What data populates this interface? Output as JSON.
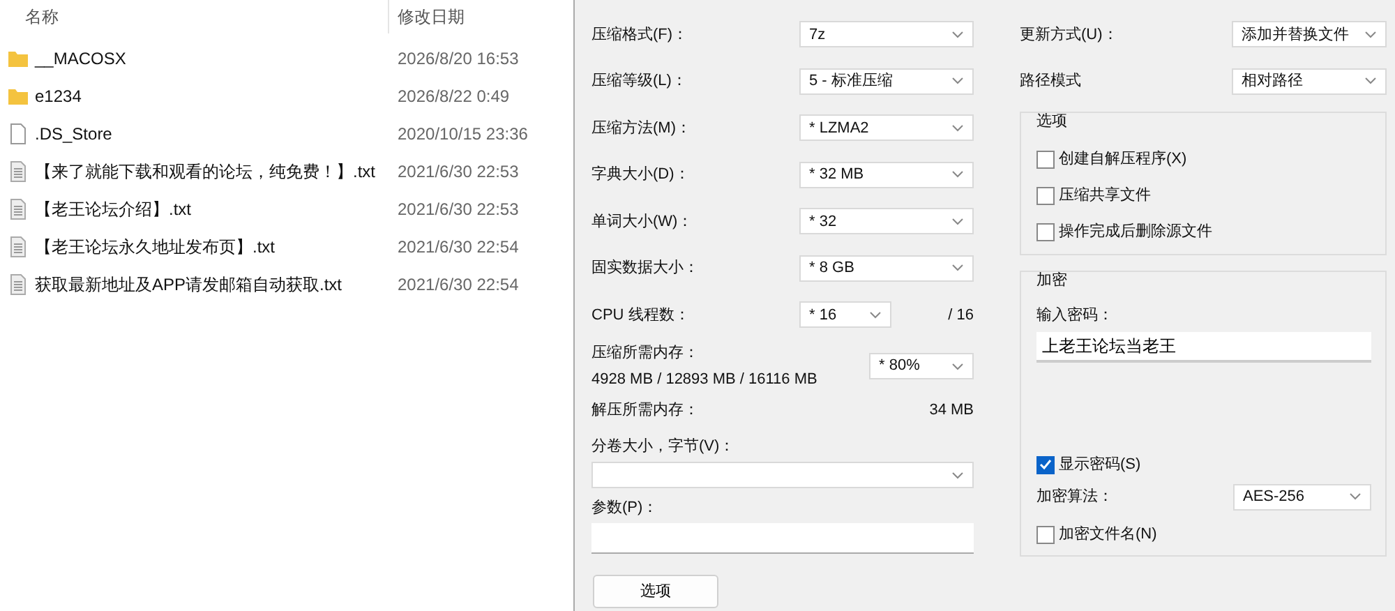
{
  "file_list": {
    "columns": [
      "名称",
      "修改日期"
    ],
    "rows": [
      {
        "kind": "folder",
        "name": "__MACOSX",
        "modified": "2026/8/20 16:53"
      },
      {
        "kind": "folder",
        "name": "e1234",
        "modified": "2026/8/22 0:49"
      },
      {
        "kind": "file",
        "name": ".DS_Store",
        "modified": "2020/10/15 23:36"
      },
      {
        "kind": "text",
        "name": "【来了就能下载和观看的论坛，纯免费！】.txt",
        "modified": "2021/6/30 22:53"
      },
      {
        "kind": "text",
        "name": "【老王论坛介绍】.txt",
        "modified": "2021/6/30 22:53"
      },
      {
        "kind": "text",
        "name": "【老王论坛永久地址发布页】.txt",
        "modified": "2021/6/30 22:54"
      },
      {
        "kind": "text",
        "name": "获取最新地址及APP请发邮箱自动获取.txt",
        "modified": "2021/6/30 22:54"
      }
    ]
  },
  "compress_dialog": {
    "left_settings": [
      {
        "label": "压缩格式(F)：",
        "value": "7z"
      },
      {
        "label": "压缩等级(L)：",
        "value": "5 - 标准压缩"
      },
      {
        "label": "压缩方法(M)：",
        "value": "* LZMA2"
      },
      {
        "label": "字典大小(D)：",
        "value": "* 32 MB"
      },
      {
        "label": "单词大小(W)：",
        "value": "* 32"
      },
      {
        "label": "固实数据大小：",
        "value": "* 8 GB"
      }
    ],
    "threads": {
      "label": "CPU 线程数：",
      "value": "* 16",
      "total": "/ 16"
    },
    "memory": {
      "label": "压缩所需内存：",
      "detail": "4928 MB / 12893 MB / 16116 MB",
      "value": "* 80%"
    },
    "decompress_memory": {
      "label": "解压所需内存：",
      "value": "34 MB"
    },
    "volume_size": {
      "label": "分卷大小，字节(V)："
    },
    "parameters": {
      "label": "参数(P)："
    },
    "options_button": "选项",
    "right_settings": [
      {
        "label": "更新方式(U)：",
        "value": "添加并替换文件"
      },
      {
        "label": "路径模式",
        "value": "相对路径"
      }
    ],
    "options_group": {
      "title": "选项",
      "checkboxes": [
        {
          "label": "创建自解压程序(X)",
          "checked": false
        },
        {
          "label": "压缩共享文件",
          "checked": false
        },
        {
          "label": "操作完成后删除源文件",
          "checked": false
        }
      ]
    },
    "encryption": {
      "title": "加密",
      "password_label": "输入密码：",
      "password": "上老王论坛当老王",
      "show_password": {
        "label": "显示密码(S)",
        "checked": true
      },
      "method_label": "加密算法：",
      "method": "AES-256",
      "encrypt_names": {
        "label": "加密文件名(N)",
        "checked": false
      }
    }
  }
}
